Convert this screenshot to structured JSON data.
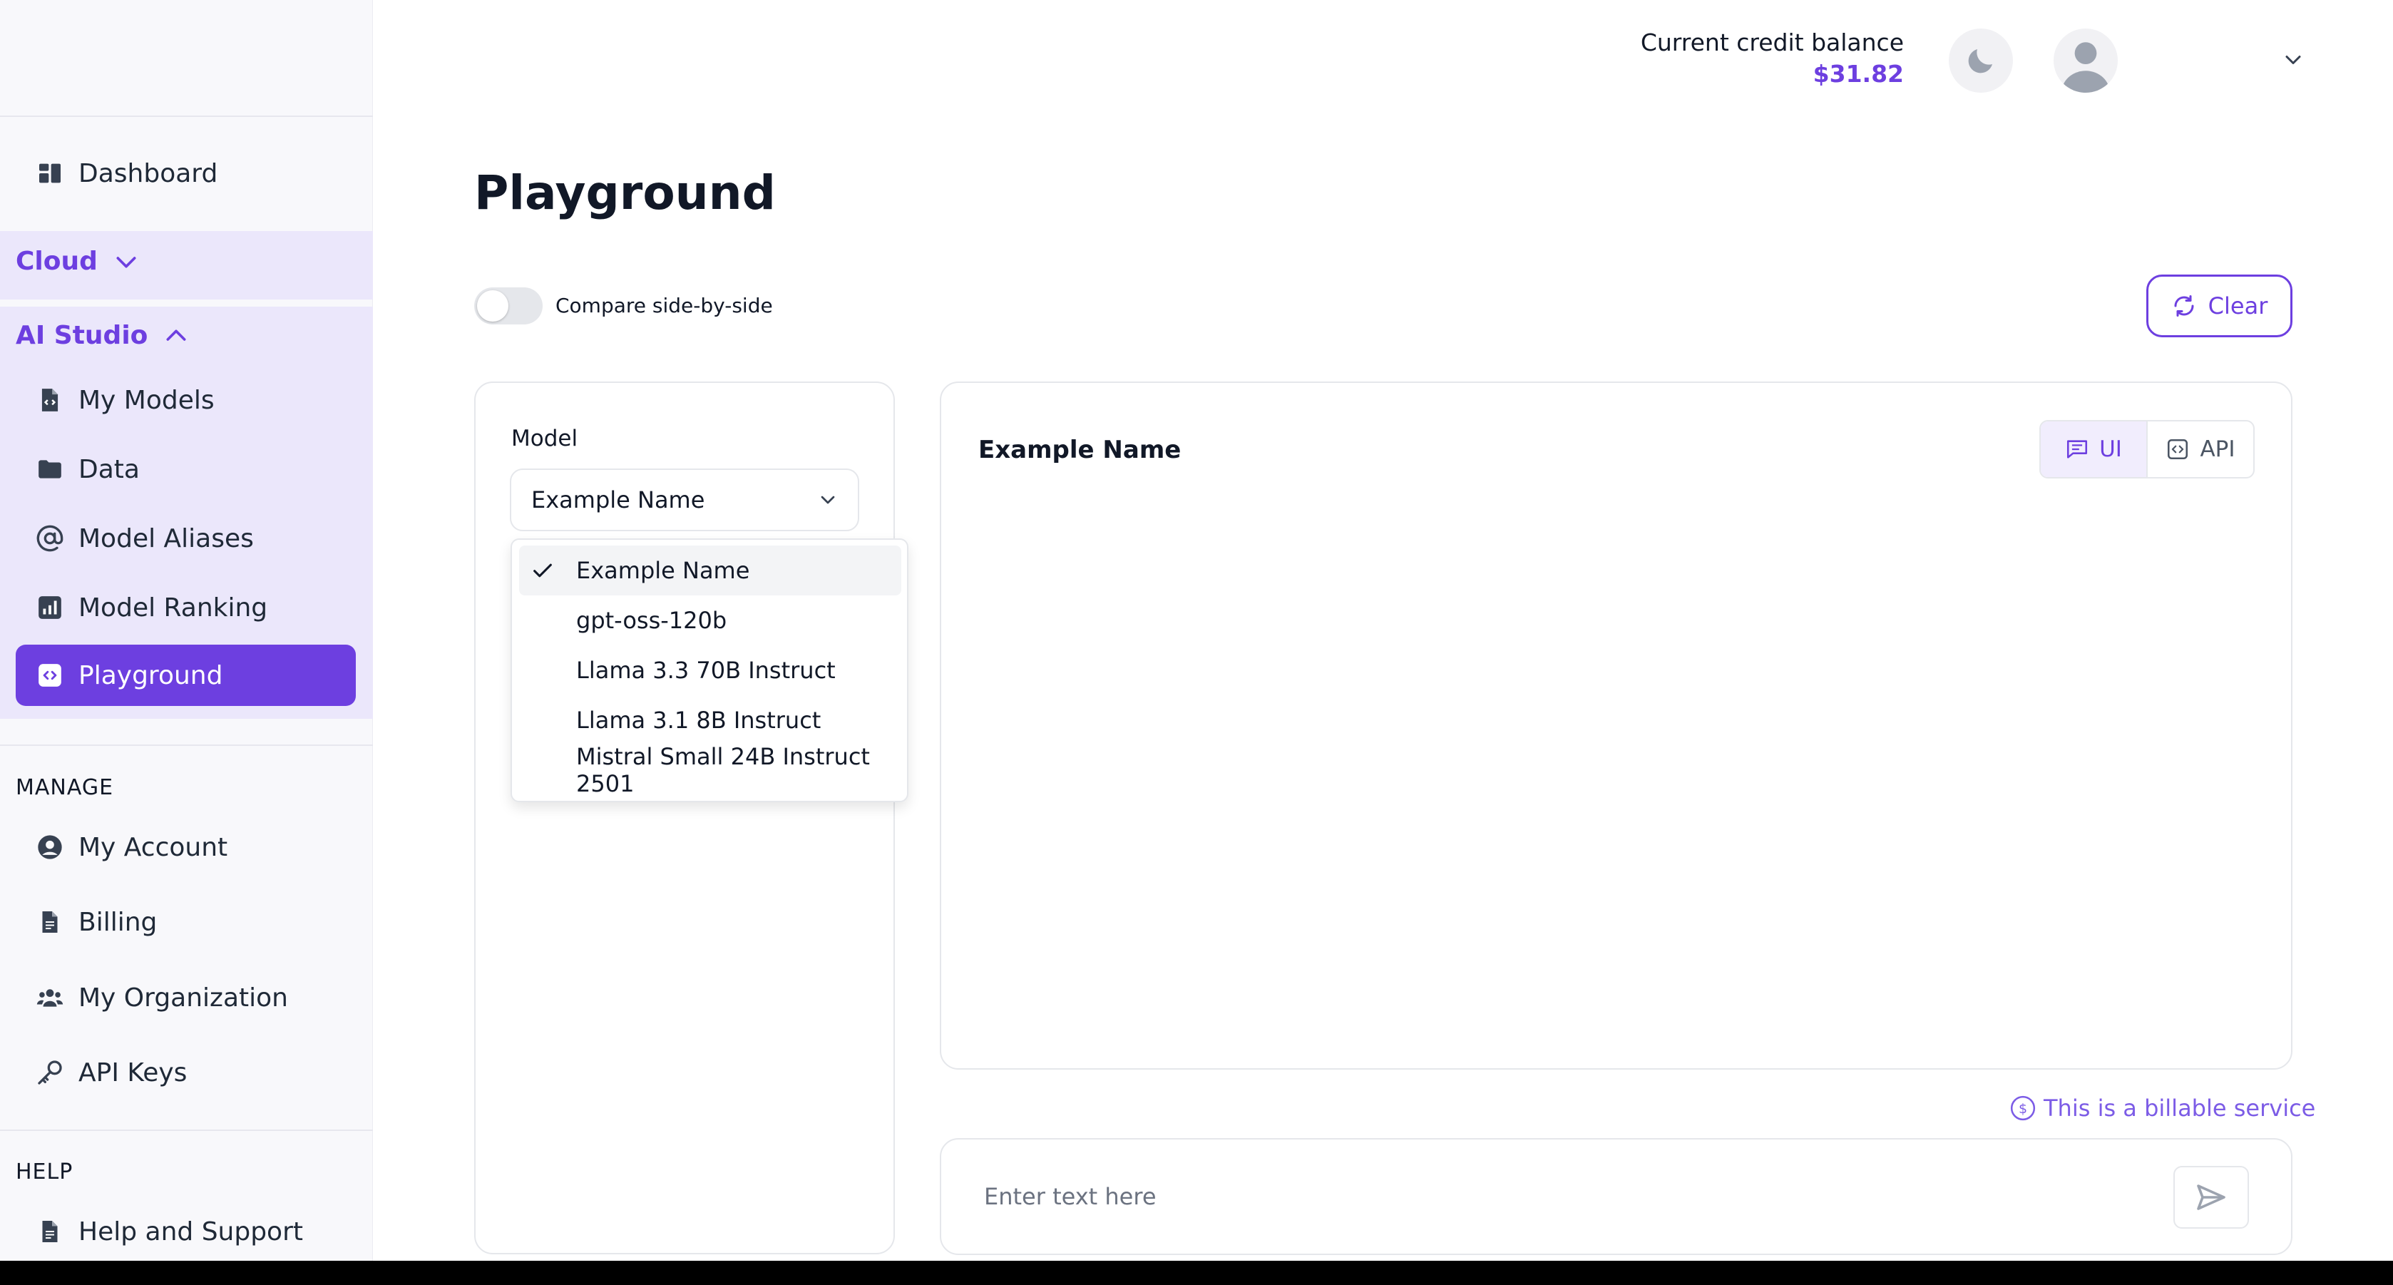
{
  "sidebar": {
    "dashboard_label": "Dashboard",
    "cloud_label": "Cloud",
    "ai_studio_label": "AI Studio",
    "ai_studio_items": [
      {
        "label": "My Models",
        "icon": "file-code-icon"
      },
      {
        "label": "Data",
        "icon": "folder-icon"
      },
      {
        "label": "Model Aliases",
        "icon": "at-sign-icon"
      },
      {
        "label": "Model Ranking",
        "icon": "bar-chart-icon"
      },
      {
        "label": "Playground",
        "icon": "code-icon"
      }
    ],
    "manage_label": "MANAGE",
    "manage_items": [
      {
        "label": "My Account",
        "icon": "user-circle-icon"
      },
      {
        "label": "Billing",
        "icon": "document-icon"
      },
      {
        "label": "My Organization",
        "icon": "users-icon"
      },
      {
        "label": "API Keys",
        "icon": "key-icon"
      }
    ],
    "help_label": "HELP",
    "help_items": [
      {
        "label": "Help and Support",
        "icon": "document-icon"
      }
    ]
  },
  "topbar": {
    "credit_label": "Current credit balance",
    "credit_value": "$31.82"
  },
  "page": {
    "title": "Playground",
    "compare_label": "Compare side-by-side",
    "clear_label": "Clear"
  },
  "model_panel": {
    "label": "Model",
    "selected": "Example Name",
    "options": [
      "Example Name",
      "gpt-oss-120b",
      "Llama 3.3 70B Instruct",
      "Llama 3.1 8B Instruct",
      "Mistral Small 24B Instruct 2501"
    ]
  },
  "chat_panel": {
    "title": "Example Name",
    "mode_ui": "UI",
    "mode_api": "API"
  },
  "billable_text": "This is a billable service",
  "input": {
    "placeholder": "Enter text here",
    "value": ""
  },
  "colors": {
    "accent": "#6d3fe0",
    "sidebar_group_bg": "#ebe7fb",
    "sidebar_bg": "#f8f8fb"
  }
}
